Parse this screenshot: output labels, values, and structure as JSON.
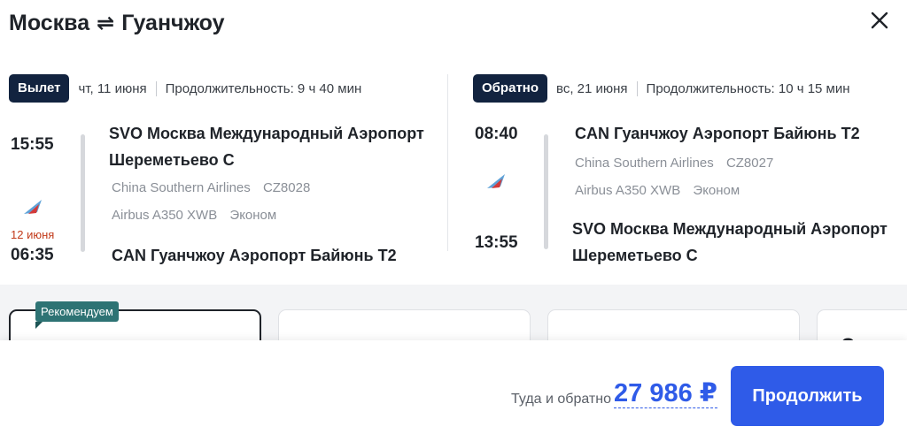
{
  "header": {
    "origin": "Москва",
    "swap_icon": "⇌",
    "destination": "Гуанчжоу",
    "close_icon": "close-icon"
  },
  "outbound": {
    "badge": "Вылет",
    "date": "чт, 11 июня",
    "duration": "Продолжительность: 9 ч 40 мин",
    "depart_time": "15:55",
    "depart_airport": "SVO Москва Международный Аэропорт Шереметьево C",
    "airline": "China Southern Airlines",
    "flight_no": "CZ8028",
    "aircraft": "Airbus A350 XWB",
    "cabin": "Эконом",
    "arrive_date_note": "12 июня",
    "arrive_time": "06:35",
    "arrive_airport": "CAN Гуанчжоу Аэропорт Байюнь T2"
  },
  "return": {
    "badge": "Обратно",
    "date": "вс, 21 июня",
    "duration": "Продолжительность: 10 ч 15 мин",
    "depart_time": "08:40",
    "depart_airport": "CAN Гуанчжоу Аэропорт Байюнь T2",
    "airline": "China Southern Airlines",
    "flight_no": "CZ8027",
    "aircraft": "Airbus A350 XWB",
    "cabin": "Эконом",
    "arrive_time": "13:55",
    "arrive_airport": "SVO Москва Международный Аэропорт Шереметьево C"
  },
  "offers": {
    "recommended_badge": "Рекомендуем",
    "partial_card_text": "Эко"
  },
  "footer": {
    "total_label": "Туда и обратно",
    "price": "27 986 ₽",
    "continue_label": "Продолжить"
  },
  "colors": {
    "accent": "#2f5be8",
    "badge_dark": "#12233f",
    "recommend": "#2e7374",
    "next_day": "#c23a1a"
  }
}
